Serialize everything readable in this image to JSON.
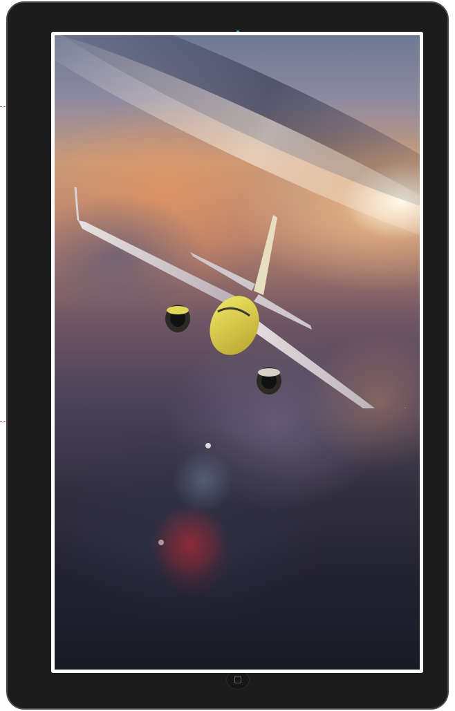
{
  "device": {
    "frame_color": "#1c1c1c",
    "bezel_border_color": "#4a4a4a",
    "camera_color": "#3fa9d6",
    "screen_border_color": "#ffffff"
  },
  "screen": {
    "content_icon": "airplane-photo-icon"
  },
  "callouts": {
    "color": "#b0312d"
  }
}
